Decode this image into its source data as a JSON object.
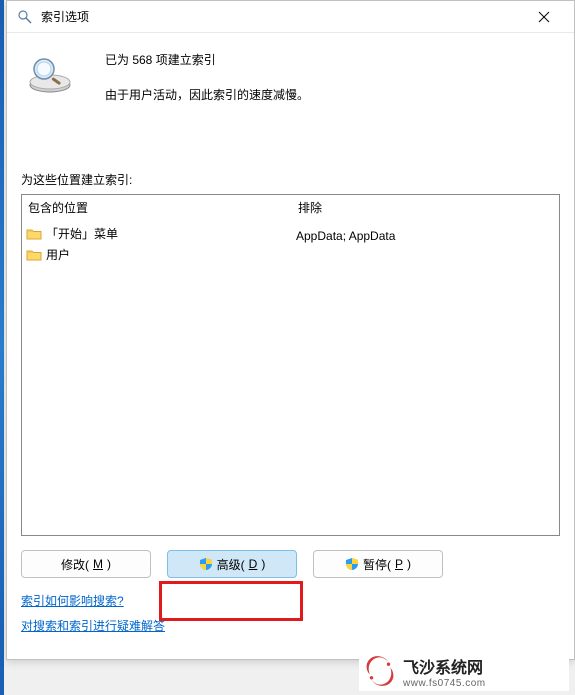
{
  "title": "索引选项",
  "info": {
    "line1": "已为 568 项建立索引",
    "line2": "由于用户活动，因此索引的速度减慢。"
  },
  "section_label": "为这些位置建立索引:",
  "table": {
    "header": {
      "col_a": "包含的位置",
      "col_b": "排除"
    },
    "rows": [
      {
        "name": "「开始」菜单",
        "exclude": ""
      },
      {
        "name": "用户",
        "exclude": "AppData; AppData"
      }
    ]
  },
  "buttons": {
    "modify": {
      "label": "修改(",
      "accel": "M",
      "suffix": ")"
    },
    "advanced": {
      "label": "高级(",
      "accel": "D",
      "suffix": ")"
    },
    "pause": {
      "label": "暂停(",
      "accel": "P",
      "suffix": ")"
    }
  },
  "links": {
    "l1": "索引如何影响搜索?",
    "l2": "对搜索和索引进行疑难解答"
  },
  "watermark": {
    "name": "飞沙系统网",
    "url": "www.fs0745.com"
  }
}
